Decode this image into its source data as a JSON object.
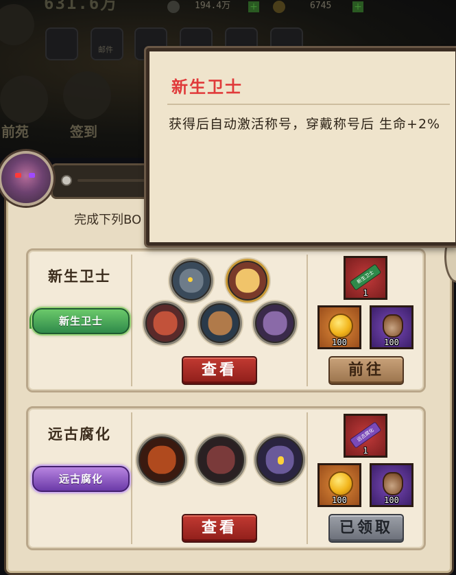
{
  "hud": {
    "power": "631.6万",
    "currency1": "194.4万",
    "currency2": "6745"
  },
  "nav": [
    {
      "label": "邮件"
    },
    {
      "label": "邮件"
    }
  ],
  "side": {
    "left_label": "前苑",
    "mid_label": "签到"
  },
  "panel": {
    "subtitle": "完成下列BO"
  },
  "tooltip": {
    "title": "新生卫士",
    "description": "获得后自动激活称号，穿戴称号后 生命+2%"
  },
  "rows": [
    {
      "name": "新生卫士",
      "badge_text": "新生卫士",
      "badge_color": "#2f8a4a",
      "view_button": "查看",
      "action_button": "前往",
      "rewards": [
        {
          "type": "title-scroll",
          "label": "新生卫士",
          "count": "1"
        },
        {
          "type": "gold-coin",
          "count": "100"
        },
        {
          "type": "loot-bag",
          "count": "100"
        }
      ]
    },
    {
      "name": "远古腐化",
      "badge_text": "远古腐化",
      "badge_color": "#6b3aa8",
      "view_button": "查看",
      "action_button": "已领取",
      "rewards": [
        {
          "type": "title-scroll",
          "label": "远古腐化",
          "count": "1"
        },
        {
          "type": "gold-coin",
          "count": "100"
        },
        {
          "type": "loot-bag",
          "count": "100"
        }
      ]
    }
  ]
}
